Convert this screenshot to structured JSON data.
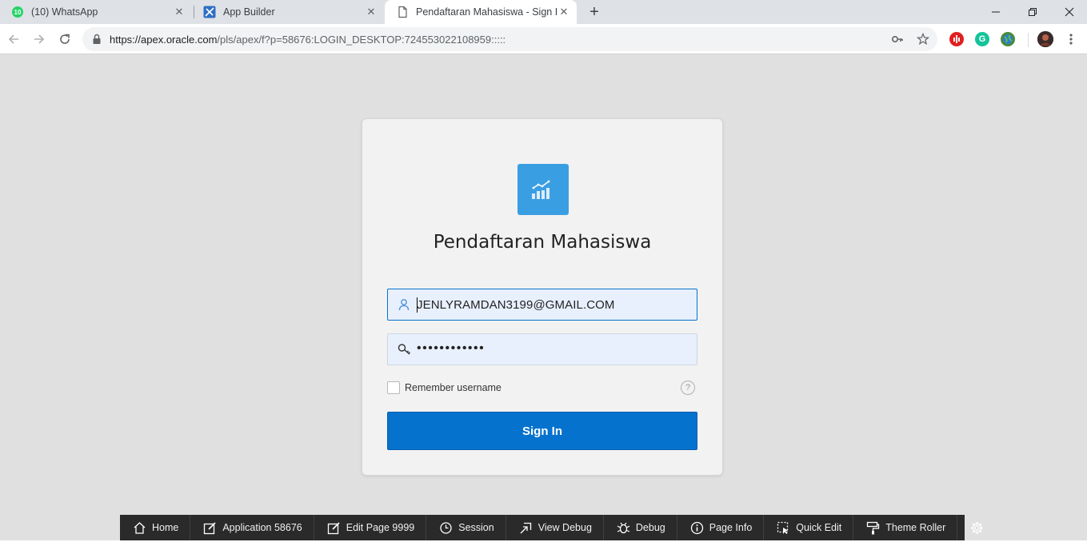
{
  "browser": {
    "tabs": [
      {
        "title": "(10) WhatsApp",
        "badge": "10"
      },
      {
        "title": "App Builder"
      },
      {
        "title": "Pendaftaran Mahasiswa - Sign In"
      }
    ],
    "address": {
      "host": "https://apex.oracle.com",
      "path": "/pls/apex/f?p=58676:LOGIN_DESKTOP:724553022108959:::::"
    }
  },
  "login": {
    "app_title": "Pendaftaran Mahasiswa",
    "username_value": "JENLYRAMDAN3199@GMAIL.COM",
    "password_mask": "••••••••••••",
    "remember_label": "Remember username",
    "help_glyph": "?",
    "signin_label": "Sign In"
  },
  "devbar": {
    "home": "Home",
    "application": "Application 58676",
    "edit_page": "Edit Page 9999",
    "session": "Session",
    "view_debug": "View Debug",
    "debug": "Debug",
    "page_info": "Page Info",
    "quick_edit": "Quick Edit",
    "theme_roller": "Theme Roller"
  },
  "colors": {
    "accent": "#0572ce",
    "app_icon": "#3a9ee2",
    "page_bg": "#e0e0e0",
    "devbar_bg": "#2a2a2a"
  }
}
